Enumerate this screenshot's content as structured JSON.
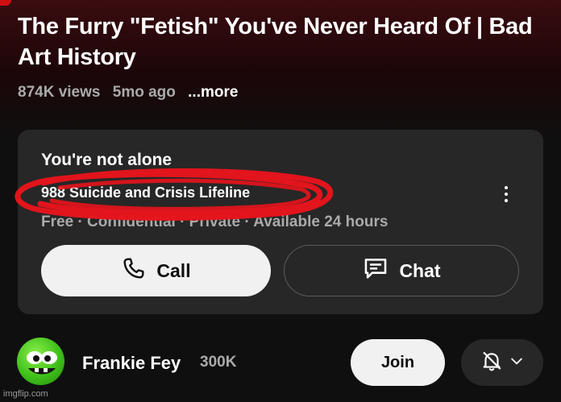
{
  "video": {
    "title": "The Furry \"Fetish\" You've Never Heard Of | Bad Art History",
    "views": "874K views",
    "age": "5mo ago",
    "more_label": "...more"
  },
  "crisis_panel": {
    "heading": "You're not alone",
    "lifeline": "988 Suicide and Crisis Lifeline",
    "subtitle": "Free · Confidential · Private · Available 24 hours",
    "call_label": "Call",
    "chat_label": "Chat",
    "icons": [
      "phone-icon",
      "chat-bubble-icon",
      "more-vertical-icon"
    ]
  },
  "channel": {
    "name": "Frankie Fey",
    "subscribers": "300K",
    "join_label": "Join",
    "bell_icon": "bell-off-icon"
  },
  "overlay": {
    "annotation_color": "#e8141c",
    "watermark": "imgflip.com"
  },
  "colors": {
    "card_bg": "#272727",
    "page_bg": "#0f0f0f",
    "header_tint": "#3a0c10"
  }
}
